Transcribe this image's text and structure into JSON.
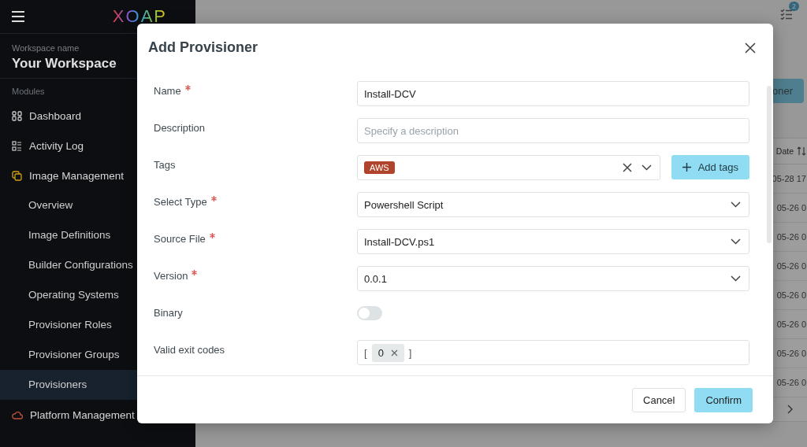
{
  "sidebar": {
    "logo": "XOAP",
    "workspace_label": "Workspace name",
    "workspace": "Your Workspace",
    "section": "Modules",
    "items": [
      {
        "label": "Dashboard",
        "selected": false
      },
      {
        "label": "Activity Log",
        "selected": false
      },
      {
        "label": "Image Management",
        "selected": false,
        "expanded": true,
        "children": [
          {
            "label": "Overview",
            "selected": false
          },
          {
            "label": "Image Definitions",
            "selected": false
          },
          {
            "label": "Builder Configurations",
            "selected": false
          },
          {
            "label": "Operating Systems",
            "selected": false
          },
          {
            "label": "Provisioner Roles",
            "selected": false
          },
          {
            "label": "Provisioner Groups",
            "selected": false
          },
          {
            "label": "Provisioners",
            "selected": true
          }
        ]
      },
      {
        "label": "Platform Management",
        "selected": false,
        "expanded": false
      }
    ]
  },
  "header": {
    "notification_count": "2"
  },
  "page": {
    "primary_button": "oner",
    "column_header": "Date",
    "rows": [
      "05-28 17",
      "05-26 0",
      "05-26 0",
      "05-26 0",
      "05-26 0",
      "05-26 0",
      "05-26 0",
      "05-26 0"
    ]
  },
  "dialog": {
    "title": "Add Provisioner",
    "fields": [
      {
        "kind": "text",
        "label": "Name",
        "required": true,
        "value": "Install-DCV"
      },
      {
        "kind": "text",
        "label": "Description",
        "required": false,
        "placeholder": "Specify a description"
      },
      {
        "kind": "tags",
        "label": "Tags",
        "required": false,
        "tags": [
          {
            "label": "AWS",
            "color": "#b0432b"
          }
        ],
        "button": "Add tags"
      },
      {
        "kind": "select",
        "label": "Select Type",
        "required": true,
        "value": "Powershell Script"
      },
      {
        "kind": "select",
        "label": "Source File",
        "required": true,
        "value": "Install-DCV.ps1"
      },
      {
        "kind": "select",
        "label": "Version",
        "required": true,
        "value": "0.0.1"
      },
      {
        "kind": "toggle",
        "label": "Binary",
        "required": false,
        "on": false
      },
      {
        "kind": "list",
        "label": "Valid exit codes",
        "required": false,
        "open": "[",
        "items": [
          "0"
        ],
        "close": "]"
      }
    ],
    "buttons": [
      {
        "label": "Cancel",
        "kind": "secondary"
      },
      {
        "label": "Confirm",
        "kind": "primary"
      }
    ]
  }
}
